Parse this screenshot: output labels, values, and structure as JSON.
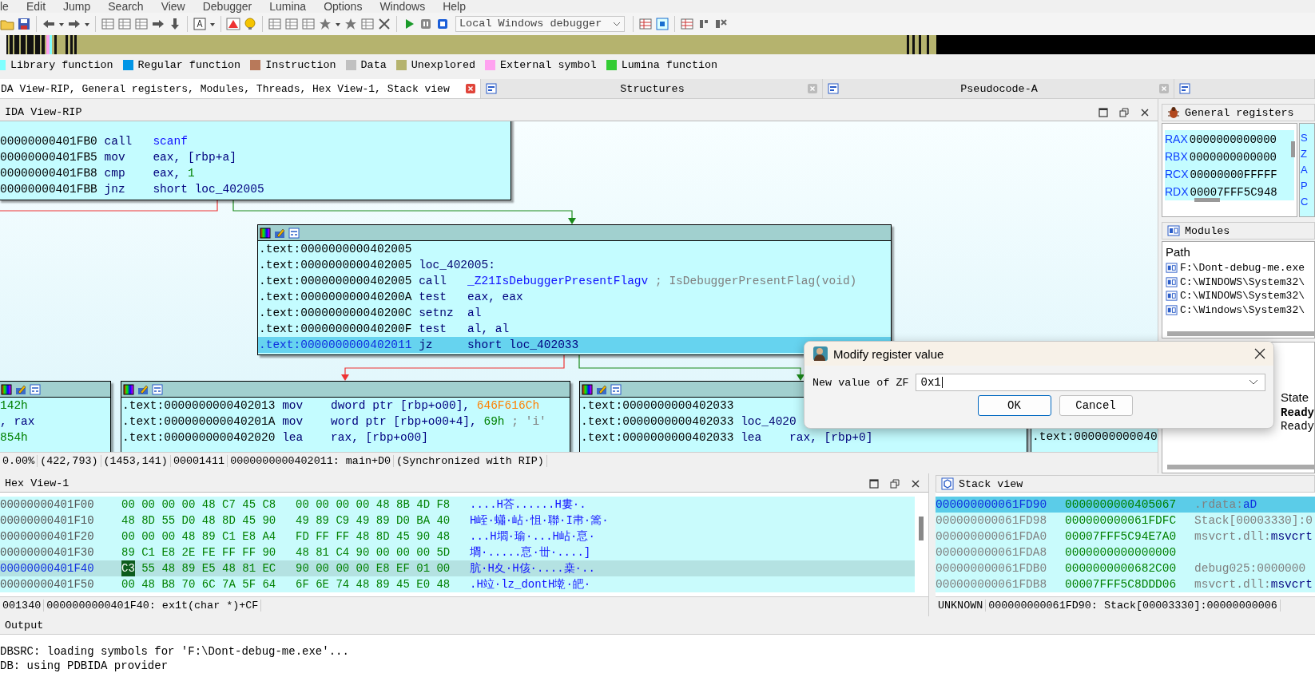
{
  "menu": [
    "le",
    "Edit",
    "Jump",
    "Search",
    "View",
    "Debugger",
    "Lumina",
    "Options",
    "Windows",
    "Help"
  ],
  "toolbar": {
    "debugger": "Local Windows debugger"
  },
  "legend": [
    {
      "label": "Library function",
      "color": "#80ffff"
    },
    {
      "label": "Regular function",
      "color": "#0095e6"
    },
    {
      "label": "Instruction",
      "color": "#b8795a"
    },
    {
      "label": "Data",
      "color": "#c0c0c0"
    },
    {
      "label": "Unexplored",
      "color": "#b5b36e"
    },
    {
      "label": "External symbol",
      "color": "#ffa2f0"
    },
    {
      "label": "Lumina function",
      "color": "#33cc33"
    }
  ],
  "tabs": [
    {
      "label": "DA View-RIP, General registers, Modules, Threads, Hex View-1, Stack view",
      "selected": true
    },
    {
      "label": "Structures",
      "selected": false
    },
    {
      "label": "Pseudocode-A",
      "selected": false
    },
    {
      "selected": false
    }
  ],
  "ida_view": {
    "title": "IDA View-RIP",
    "nodes": [
      {
        "lines": [
          {
            "addr": "00000000401FB0",
            "op": "call",
            "args": [
              {
                "t": "scanf",
                "kind": "sym"
              }
            ],
            "selected": false
          },
          {
            "addr": "00000000401FB5",
            "op": "mov",
            "args": [
              {
                "t": "eax, [rbp+a]",
                "kind": "reg"
              }
            ],
            "selected": false
          },
          {
            "addr": "00000000401FB8",
            "op": "cmp",
            "args": [
              {
                "t": "eax, ",
                "kind": "reg"
              },
              {
                "t": "1",
                "kind": "num"
              }
            ],
            "selected": false
          },
          {
            "addr": "00000000401FBB",
            "op": "jnz",
            "args": [
              {
                "t": "short loc_402005",
                "kind": "reg"
              }
            ],
            "selected": false
          }
        ]
      },
      {
        "lines": [
          {
            "addr": ".text:0000000000402005",
            "selected": false
          },
          {
            "addr": ".text:0000000000402005",
            "op": "loc_402005:",
            "selected": false
          },
          {
            "addr": ".text:0000000000402005",
            "op": "call",
            "args": [
              {
                "t": "_Z21IsDebuggerPresentFlagv",
                "kind": "sym"
              },
              {
                "t": " ; IsDebuggerPresentFlag(void)",
                "kind": "cmt"
              }
            ],
            "selected": false
          },
          {
            "addr": ".text:000000000040200A",
            "op": "test",
            "args": [
              {
                "t": "eax, eax",
                "kind": "reg"
              }
            ],
            "selected": false
          },
          {
            "addr": ".text:000000000040200C",
            "op": "setnz",
            "args": [
              {
                "t": "al",
                "kind": "reg"
              }
            ],
            "selected": false
          },
          {
            "addr": ".text:000000000040200F",
            "op": "test",
            "args": [
              {
                "t": "al, al",
                "kind": "reg"
              }
            ],
            "selected": false
          },
          {
            "addr": ".text:0000000000402011",
            "op": "jz",
            "args": [
              {
                "t": "short loc_402033",
                "kind": "reg"
              }
            ],
            "selected": true
          }
        ]
      },
      {
        "lines": [
          {
            "args": [
              {
                "t": "142h",
                "kind": "num"
              }
            ],
            "selected": false
          },
          {
            "args": [
              {
                "t": ", rax",
                "kind": "reg"
              }
            ],
            "selected": false
          },
          {
            "args": [
              {
                "t": "854h",
                "kind": "num"
              }
            ],
            "selected": false
          }
        ]
      },
      {
        "lines": [
          {
            "addr": ".text:0000000000402013",
            "op": "mov",
            "args": [
              {
                "t": "dword ptr [rbp+o00], ",
                "kind": "reg"
              },
              {
                "t": "646F616Ch",
                "kind": "hex"
              }
            ],
            "selected": false
          },
          {
            "addr": ".text:000000000040201A",
            "op": "mov",
            "args": [
              {
                "t": "word ptr [rbp+o00+4], ",
                "kind": "reg"
              },
              {
                "t": "69h",
                "kind": "num"
              },
              {
                "t": " ; 'i'",
                "kind": "cmt"
              }
            ],
            "selected": false
          },
          {
            "addr": ".text:0000000000402020",
            "op": "lea",
            "args": [
              {
                "t": "rax, [rbp+o00]",
                "kind": "reg"
              }
            ],
            "selected": false
          }
        ]
      },
      {
        "lines": [
          {
            "addr": ".text:0000000000402033",
            "selected": false
          },
          {
            "addr": ".text:0000000000402033",
            "op": "loc_4020",
            "selected": false
          },
          {
            "addr": ".text:0000000000402033",
            "op": "lea",
            "args": [
              {
                "t": "rax, [rbp+0]",
                "kind": "reg"
              }
            ],
            "selected": false
          }
        ]
      },
      {
        "lines": [
          {
            "addr": ".text:000000000040",
            "selected": false
          }
        ]
      }
    ],
    "status": [
      "0.00%",
      "(422,793)",
      "(1453,141)",
      "00001411",
      "0000000000402011: main+D0",
      "(Synchronized with RIP)"
    ]
  },
  "registers": {
    "title": "General registers",
    "rows": [
      {
        "name": "RAX",
        "value": "0000000000000"
      },
      {
        "name": "RBX",
        "value": "0000000000000"
      },
      {
        "name": "RCX",
        "value": "00000000FFFFF"
      },
      {
        "name": "RDX",
        "value": "00007FFF5C948"
      }
    ],
    "flags": [
      "S",
      "Z",
      "A",
      "P",
      "C"
    ]
  },
  "modules": {
    "title": "Modules",
    "column": "Path",
    "rows": [
      "F:\\Dont-debug-me.exe",
      "C:\\WINDOWS\\System32\\",
      "C:\\WINDOWS\\System32\\",
      "C:\\Windows\\System32\\"
    ]
  },
  "threads": {
    "column": "State",
    "rows": [
      {
        "state": "Ready",
        "selected": true
      },
      {
        "state": "Ready",
        "selected": false
      }
    ]
  },
  "dialog": {
    "title": "Modify register value",
    "label": "New value of ZF",
    "value": "0x1",
    "buttons": [
      "OK",
      "Cancel"
    ]
  },
  "hex_view": {
    "title": "Hex View-1",
    "rows": [
      {
        "addr": "00000000401F00",
        "g1": "00 00 00 00 48 C7 45 C8",
        "g2": "00 00 00 00 48 8B 4D F8",
        "ascii": "....H荅......H婁·.",
        "selected": false
      },
      {
        "addr": "00000000401F10",
        "g1": "48 8D 55 D0 48 8D 45 90",
        "g2": "49 89 C9 49 89 D0 BA 40",
        "ascii": "H峌·蠨·岾·怚·聯·I帇·篙·",
        "selected": false
      },
      {
        "addr": "00000000401F20",
        "g1": "00 00 00 48 89 C1 E8 A4",
        "g2": "FD FF FF 48 8D 45 90 48",
        "ascii": "...H壛·瑜·...H岾·恴·",
        "selected": false
      },
      {
        "addr": "00000000401F30",
        "g1": "89 C1 E8 2E FE FF FF 90",
        "g2": "48 81 C4 90 00 00 00 5D",
        "ascii": "墹·.....恴·丗·....]",
        "selected": false
      },
      {
        "addr": "00000000401F40",
        "cursor": "C3",
        "g1": "55 48 89 E5 48 81 EC",
        "g2": "90 00 00 00 E8 EF 01 00",
        "ascii": "肮·H夊·H侅·....桒·..",
        "selected": true
      },
      {
        "addr": "00000000401F50",
        "g1": "00 48 B8 70 6C 7A 5F 64",
        "g2": "6F 6E 74 48 89 45 E0 48",
        "ascii": ".H竝·lz_dontH墘·皅·",
        "selected": false
      }
    ],
    "status": [
      "001340",
      "0000000000401F40: ex1t(char *)+CF"
    ]
  },
  "stack_view": {
    "title": "Stack view",
    "rows": [
      {
        "addr": "000000000061FD90",
        "value": "0000000000405067",
        "segment": ".rdata:",
        "symbol": "aD",
        "selected": true
      },
      {
        "addr": "000000000061FD98",
        "value": "000000000061FDFC",
        "segment": "Stack[00003330]:0",
        "selected": false
      },
      {
        "addr": "000000000061FDA0",
        "value": "00007FFF5C94E7A0",
        "segment": "msvcrt.dll:",
        "symbol": "msvcrt",
        "selected": false
      },
      {
        "addr": "000000000061FDA8",
        "value": "0000000000000000",
        "selected": false
      },
      {
        "addr": "000000000061FDB0",
        "value": "0000000000682C00",
        "segment": "debug025:0000000",
        "selected": false
      },
      {
        "addr": "000000000061FDB8",
        "value": "00007FFF5C8DDD06",
        "segment": "msvcrt.dll:",
        "symbol": "msvcrt",
        "selected": false
      }
    ],
    "status": [
      "UNKNOWN",
      "000000000061FD90: Stack[00003330]:00000000006"
    ]
  },
  "output": {
    "title": "Output",
    "lines": [
      "DBSRC: loading symbols for 'F:\\Dont-debug-me.exe'...",
      "DB: using PDBIDA provider"
    ]
  }
}
